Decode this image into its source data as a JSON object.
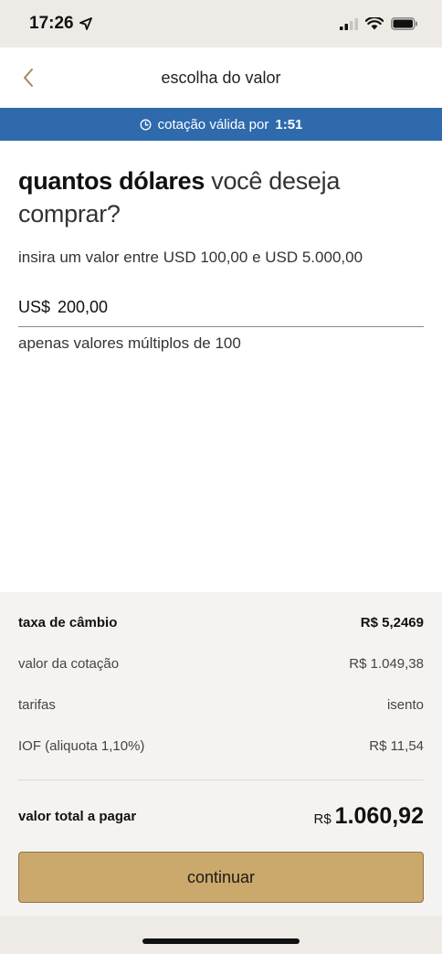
{
  "status_bar": {
    "time": "17:26"
  },
  "nav": {
    "title": "escolha do valor"
  },
  "timer": {
    "label": "cotação válida por",
    "value": "1:51"
  },
  "question": {
    "bold": "quantos dólares",
    "rest": "você deseja comprar?"
  },
  "range_hint": "insira um valor entre USD 100,00 e USD 5.000,00",
  "amount": {
    "currency": "US$",
    "value": "200,00"
  },
  "helper": "apenas valores múltiplos de 100",
  "summary": {
    "rows": [
      {
        "label": "taxa de câmbio",
        "value": "R$ 5,2469"
      },
      {
        "label": "valor da cotação",
        "value": "R$ 1.049,38"
      },
      {
        "label": "tarifas",
        "value": "isento"
      },
      {
        "label": "IOF (aliquota 1,10%)",
        "value": "R$ 11,54"
      }
    ],
    "total_label": "valor total a pagar",
    "total_currency": "R$",
    "total_amount": "1.060,92"
  },
  "continue_label": "continuar",
  "colors": {
    "banner": "#2f6aad",
    "button": "#cba86b",
    "summary_bg": "#f5f3f1",
    "chrome_bg": "#eeebe7",
    "back_arrow": "#a5885a"
  }
}
